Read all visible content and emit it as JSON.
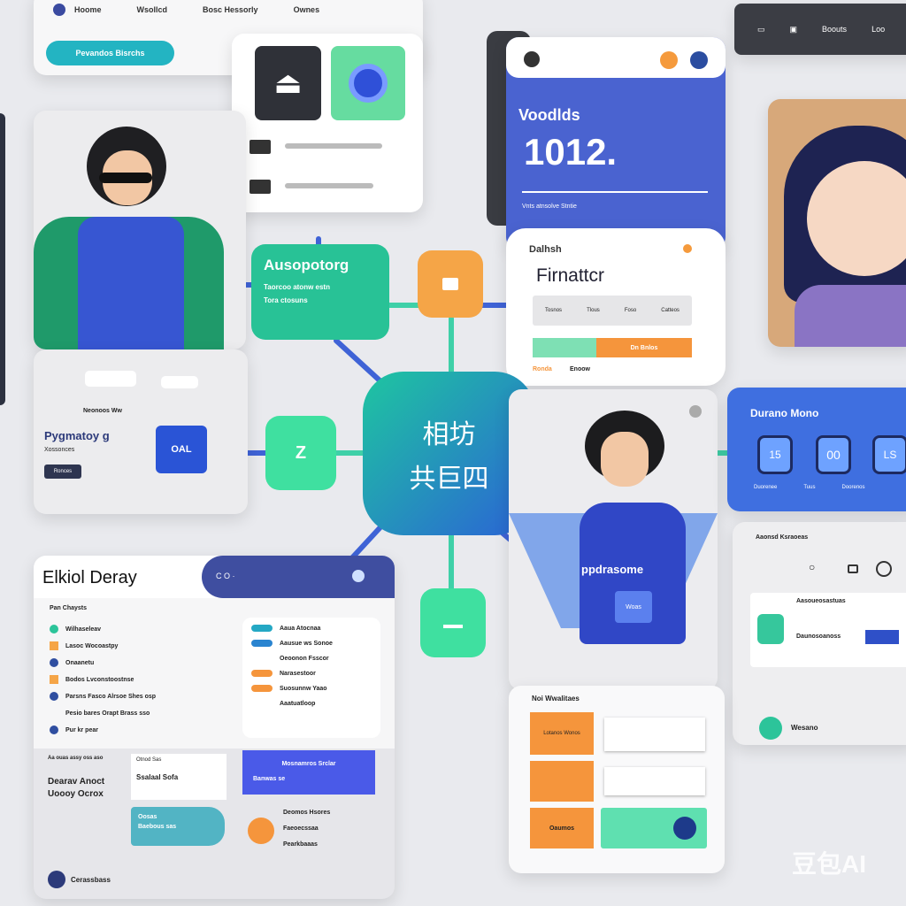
{
  "colors": {
    "blue": "#4a63d6",
    "teal": "#25c2a0",
    "orange": "#f59a3c",
    "navy": "#2c3a7a",
    "bg": "#e9eaee"
  },
  "top_nav": {
    "items": [
      "Hoome",
      "Wsollcd",
      "Bosc Hessorly",
      "Ownes"
    ],
    "button": "Pevandos Bisrchs"
  },
  "top_right_bar": {
    "items": [
      "",
      "",
      "Boouts",
      "Loo"
    ]
  },
  "stats_card": {
    "label": "Voodlds",
    "value": "1012.",
    "footer": "Vnts atnsolve Stntie"
  },
  "form_card": {
    "header": "Dalhsh",
    "title": "Firnattcr",
    "columns": [
      "Tosnos",
      "Tlous",
      "Foso",
      "Catteos"
    ],
    "button": "Dn Bnlos",
    "links": [
      "Ronda",
      "Enoow"
    ]
  },
  "hub": {
    "title_line1": "相坊",
    "title_line2": "共巨四"
  },
  "node_auto": {
    "title": "Ausopotorg",
    "line1": "Taorcoo atonw estn",
    "line2": "Tora ctosuns"
  },
  "node_z": {
    "label": "Z"
  },
  "left_panel": {
    "title": "Pygmatoy g",
    "subtitle": "Xossonces",
    "button": "Ronces",
    "badge": "OAL",
    "chip": "Neonoos Ww"
  },
  "device_panel": {
    "title": "Durano Mono",
    "tiles": [
      "15",
      "00",
      "LS"
    ],
    "labels": [
      "Duorenee",
      "Tuus",
      "Doorenos"
    ]
  },
  "person_card": {
    "label": "ppdrasome",
    "button": "Woas"
  },
  "list_panel": {
    "title": "Noi Wwalitaes",
    "orange_items": [
      "Lotanos Wonos",
      "",
      "Oaumos"
    ]
  },
  "dashboard": {
    "title": "Elkiol Deray",
    "header_tabs": "C O ·",
    "section": "Pan Chaysts",
    "list": [
      "Wilhaseleav",
      "Lasoc Wocoastpy",
      "Onaanetu",
      "Bodos Lvconstoostnse",
      "Parsns Fasco Alrsoe  Shes osp",
      "Pesio bares Orapt Brass sso",
      "Pur kr pear"
    ],
    "right_list": [
      "Aaua Atocnaa",
      "Aausue ws Sonoe",
      "Oeoonon Fsscor",
      "Narasestoor",
      "Suosunnw Yaao",
      "Aaatuatloop"
    ],
    "bottom_left": {
      "caption": "Aa ouas assy oss aso",
      "title1": "Dearav Anoct",
      "title2": "Uoooy Ocrox"
    },
    "white_box": {
      "header": "Otnod Sas",
      "value": "Ssalaal Sofa"
    },
    "blue_box": {
      "title": "Mosnamros Srclar",
      "sub": "Banwas se"
    },
    "teal_box": {
      "line1": "Oosas",
      "line2": "Baebous sas"
    },
    "orange_list": [
      "Deomos Hsores",
      "Faeoecssaa",
      "Pearkbaaas"
    ],
    "footer": "Cerassbass"
  },
  "right_card": {
    "title": "Aaonsd Ksraoeas",
    "row1": "Aasoueosastuas",
    "row2": "Daunosoanoss",
    "footer": "Wesano"
  },
  "watermark": "豆包AI"
}
